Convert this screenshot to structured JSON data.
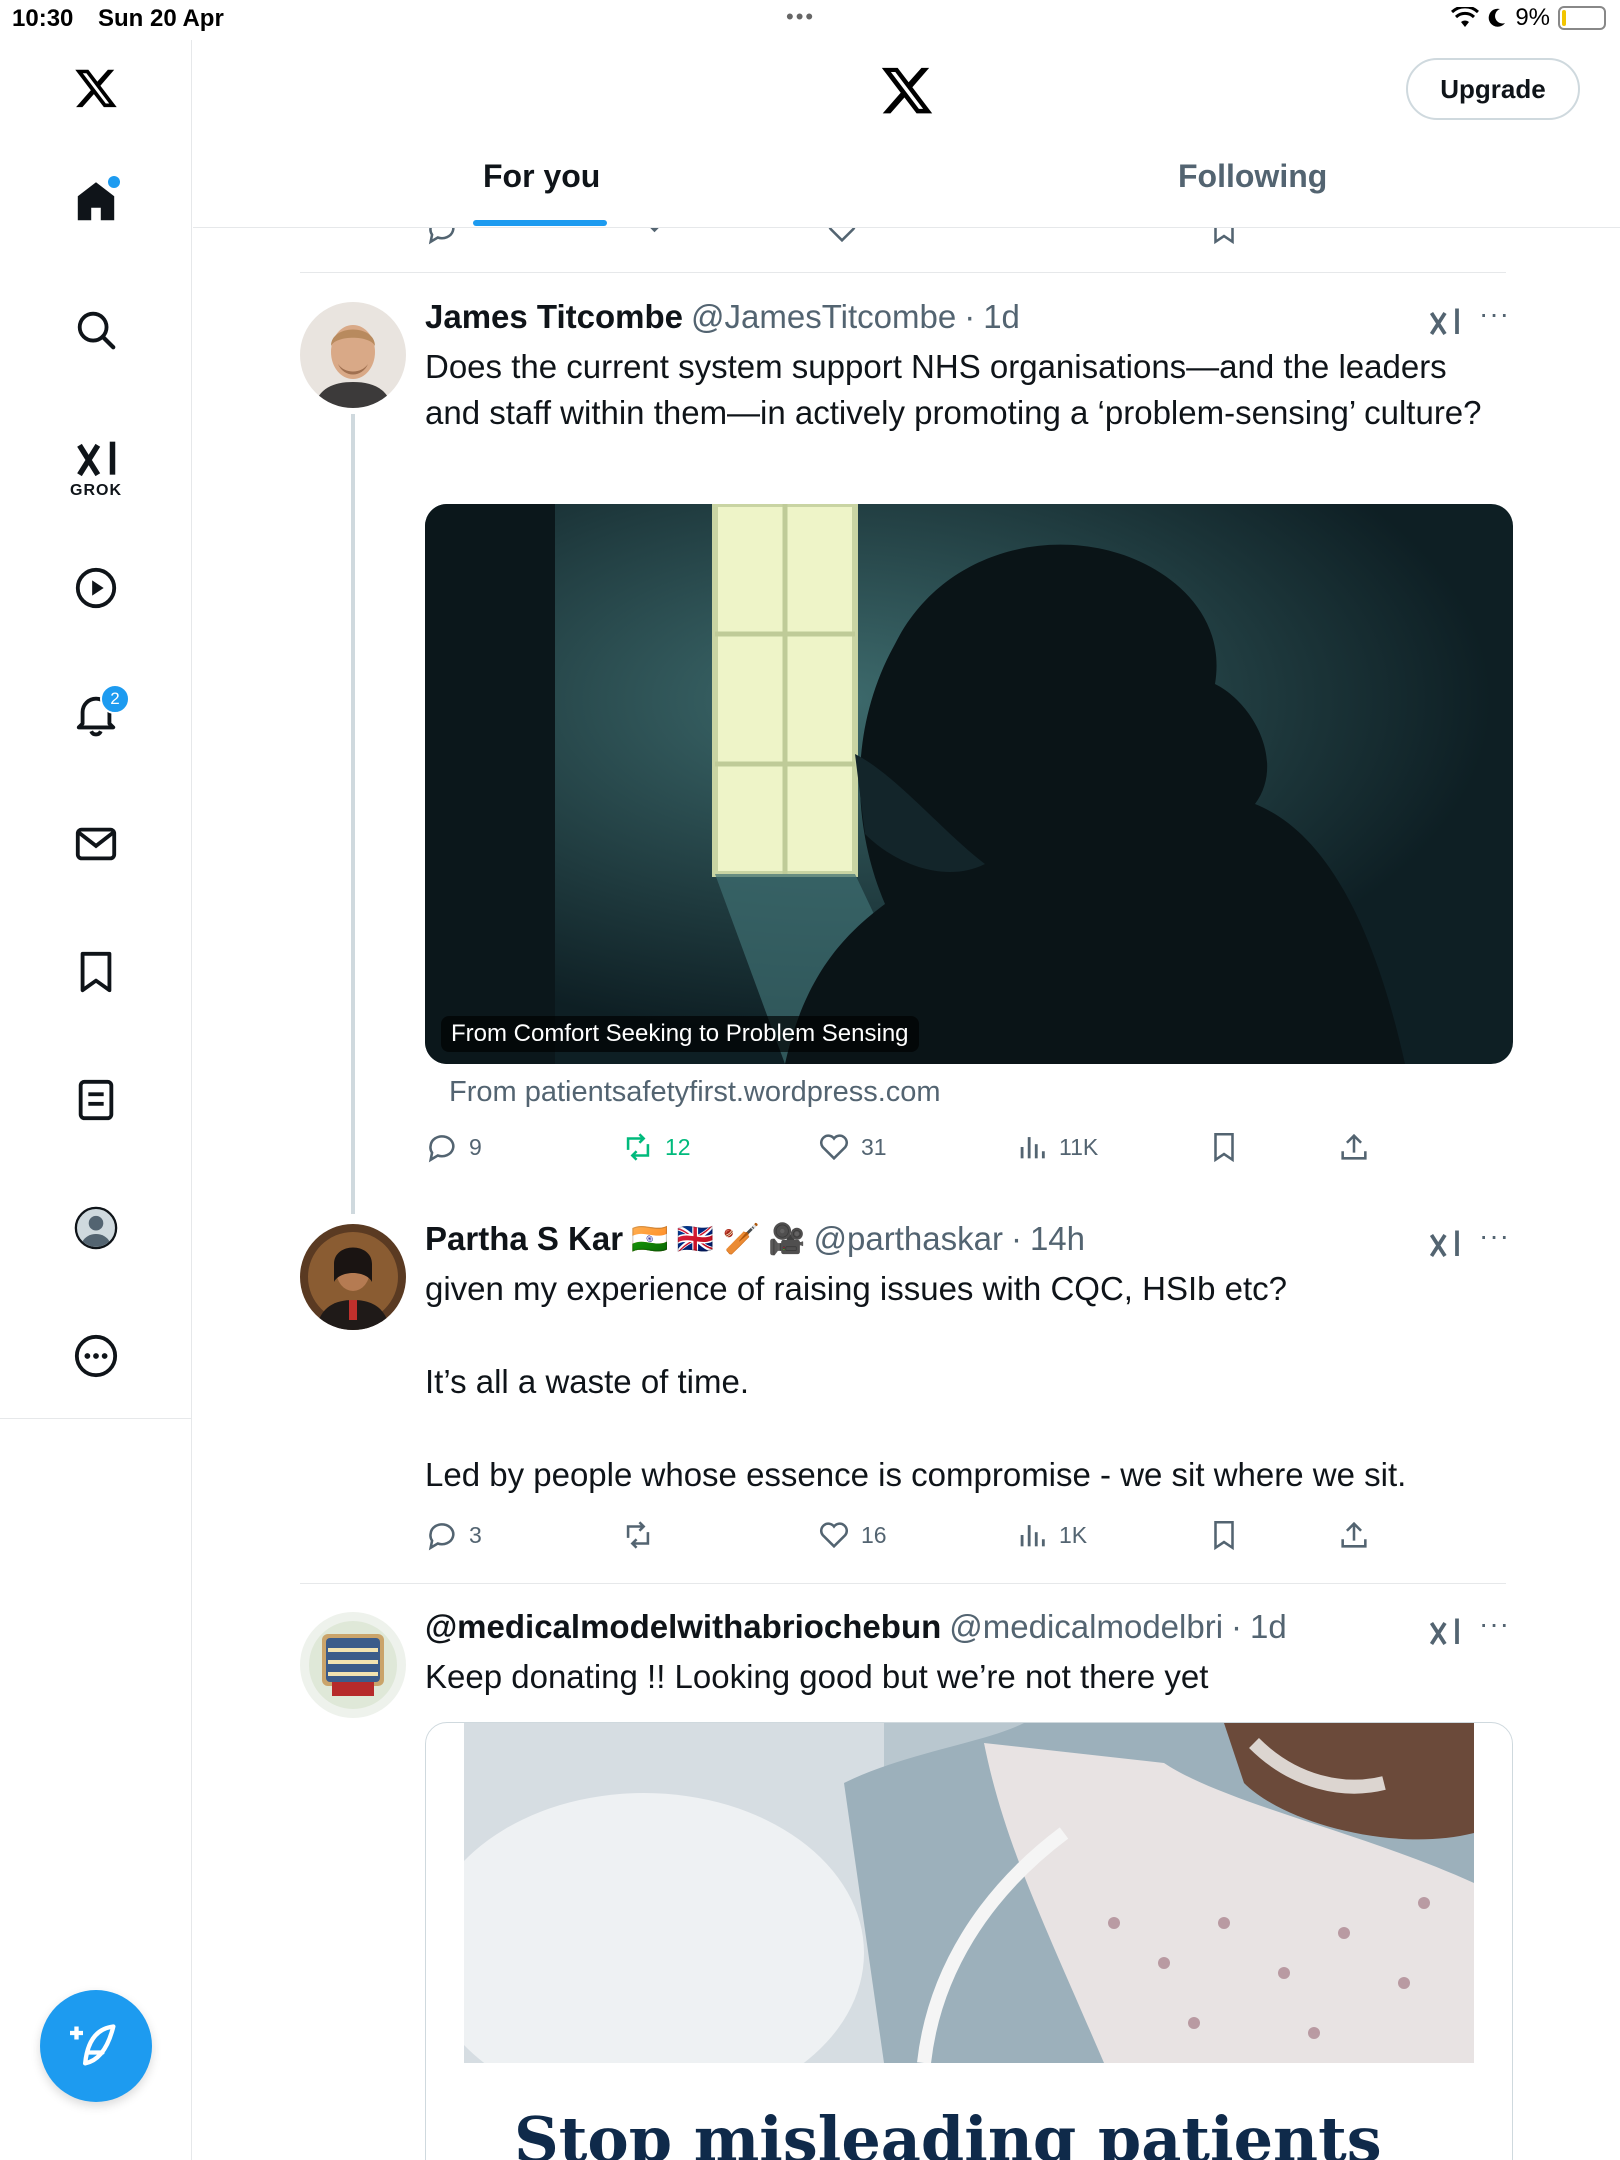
{
  "status_bar": {
    "time": "10:30",
    "date": "Sun 20 Apr",
    "battery": "9%",
    "battery_level": 0.09
  },
  "header": {
    "upgrade_label": "Upgrade",
    "tabs": [
      {
        "label": "For you",
        "active": true
      },
      {
        "label": "Following",
        "active": false
      }
    ]
  },
  "sidebar": {
    "items": [
      "home-icon",
      "search-icon",
      "grok-icon",
      "video-icon",
      "notifications-icon",
      "messages-icon",
      "bookmarks-icon",
      "lists-icon",
      "profile-icon",
      "more-icon"
    ],
    "grok_label": "GROK",
    "notification_count": "2"
  },
  "tweets": [
    {
      "name": "James Titcombe",
      "handle": "@JamesTitcombe",
      "time": "1d",
      "text": "Does the current system support NHS organisations—and the leaders and staff within them—in actively promoting a ‘problem-sensing’ culture?",
      "media_caption": "From Comfort Seeking to Problem Sensing",
      "link_source": "From patientsafetyfirst.wordpress.com",
      "replies": "9",
      "retweets": "12",
      "likes": "31",
      "views": "11K"
    },
    {
      "name": "Partha S Kar",
      "name_emoji": "🇮🇳 🇬🇧 🏏 🎥",
      "handle": "@parthaskar",
      "time": "14h",
      "text_lines": [
        "given my experience of raising issues with CQC, HSIb etc?",
        "It’s all a waste of time.",
        "Led by people whose essence is compromise - we sit where we sit."
      ],
      "replies": "3",
      "retweets": "",
      "likes": "16",
      "views": "1K"
    },
    {
      "name": "@medicalmodelwithabriochebun",
      "handle": "@medicalmodelbri",
      "time": "1d",
      "text": "Keep donating !! Looking good but we’re not there yet",
      "card_headline": "Stop misleading patients"
    }
  ],
  "colors": {
    "accent": "#1d9bf0",
    "retweet_active": "#00ba7c",
    "secondary_text": "#536471"
  }
}
